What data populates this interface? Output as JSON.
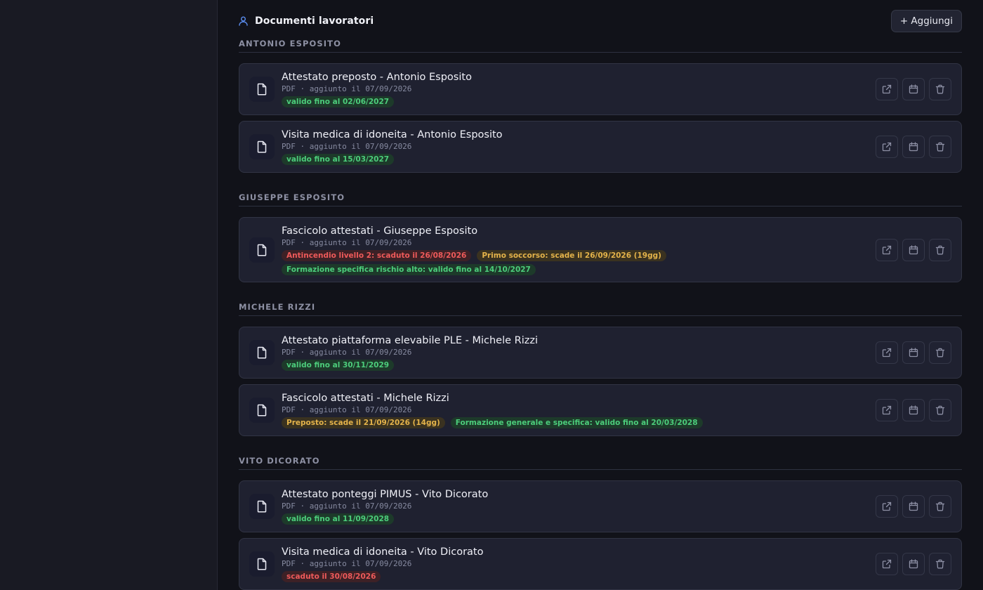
{
  "header": {
    "title": "Documenti lavoratori",
    "add_label": "+ Aggiungi"
  },
  "groups": [
    {
      "name": "ANTONIO ESPOSITO",
      "docs": [
        {
          "title": "Attestato preposto - Antonio Esposito",
          "meta": "PDF · aggiunto il 07/09/2026",
          "badges": [
            {
              "text": "valido fino al 02/06/2027",
              "status": "ok"
            }
          ]
        },
        {
          "title": "Visita medica di idoneita - Antonio Esposito",
          "meta": "PDF · aggiunto il 07/09/2026",
          "badges": [
            {
              "text": "valido fino al 15/03/2027",
              "status": "ok"
            }
          ]
        }
      ]
    },
    {
      "name": "GIUSEPPE ESPOSITO",
      "docs": [
        {
          "title": "Fascicolo attestati - Giuseppe Esposito",
          "meta": "PDF · aggiunto il 07/09/2026",
          "badges": [
            {
              "text": "Antincendio livello 2: scaduto il 26/08/2026",
              "status": "err"
            },
            {
              "text": "Primo soccorso: scade il 26/09/2026 (19gg)",
              "status": "warn"
            },
            {
              "text": "Formazione specifica rischio alto: valido fino al 14/10/2027",
              "status": "ok"
            }
          ]
        }
      ]
    },
    {
      "name": "MICHELE RIZZI",
      "docs": [
        {
          "title": "Attestato piattaforma elevabile PLE - Michele Rizzi",
          "meta": "PDF · aggiunto il 07/09/2026",
          "badges": [
            {
              "text": "valido fino al 30/11/2029",
              "status": "ok"
            }
          ]
        },
        {
          "title": "Fascicolo attestati - Michele Rizzi",
          "meta": "PDF · aggiunto il 07/09/2026",
          "badges": [
            {
              "text": "Preposto: scade il 21/09/2026 (14gg)",
              "status": "warn"
            },
            {
              "text": "Formazione generale e specifica: valido fino al 20/03/2028",
              "status": "ok"
            }
          ]
        }
      ]
    },
    {
      "name": "VITO DICORATO",
      "docs": [
        {
          "title": "Attestato ponteggi PIMUS - Vito Dicorato",
          "meta": "PDF · aggiunto il 07/09/2026",
          "badges": [
            {
              "text": "valido fino al 11/09/2028",
              "status": "ok"
            }
          ]
        },
        {
          "title": "Visita medica di idoneita - Vito Dicorato",
          "meta": "PDF · aggiunto il 07/09/2026",
          "badges": [
            {
              "text": "scaduto il 30/08/2026",
              "status": "err"
            }
          ]
        }
      ]
    }
  ],
  "icons": {
    "header": "user-icon",
    "document": "file-icon",
    "actions": [
      "external-link-icon",
      "calendar-icon",
      "trash-icon"
    ]
  },
  "colors": {
    "accent": "#5b8def",
    "ok": "#4ccd7b",
    "warn": "#e4b34a",
    "err": "#ef5a5a"
  }
}
